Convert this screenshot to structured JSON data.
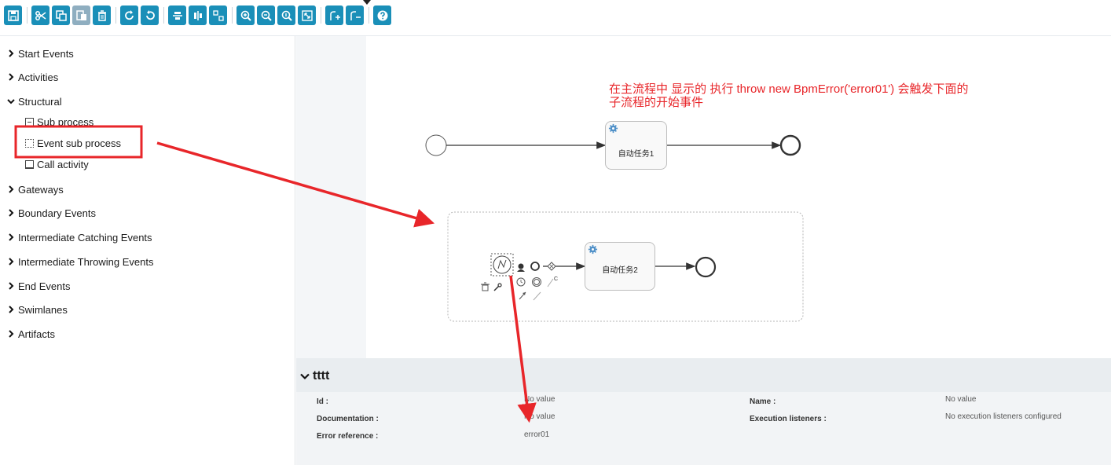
{
  "palette": {
    "groups": [
      {
        "label": "Start Events",
        "expanded": false
      },
      {
        "label": "Activities",
        "expanded": false
      },
      {
        "label": "Structural",
        "expanded": true
      },
      {
        "label": "Gateways",
        "expanded": false
      },
      {
        "label": "Boundary Events",
        "expanded": false
      },
      {
        "label": "Intermediate Catching Events",
        "expanded": false
      },
      {
        "label": "Intermediate Throwing Events",
        "expanded": false
      },
      {
        "label": "End Events",
        "expanded": false
      },
      {
        "label": "Swimlanes",
        "expanded": false
      },
      {
        "label": "Artifacts",
        "expanded": false
      }
    ],
    "structural_items": [
      "Sub process",
      "Event sub process",
      "Call activity"
    ]
  },
  "canvas": {
    "annotation_line1": "在主流程中 显示的 执行 throw new BpmError('error01') 会触发下面的",
    "annotation_line2": "子流程的开始事件",
    "task1_label": "自动任务1",
    "task2_label": "自动任务2"
  },
  "properties": {
    "title": "tttt",
    "rows": [
      {
        "label": "Id :",
        "value": "No value"
      },
      {
        "label": "Documentation :",
        "value": "No value"
      },
      {
        "label": "Error reference :",
        "value": "error01"
      }
    ],
    "rows_right": [
      {
        "label": "Name :",
        "value": "No value"
      },
      {
        "label": "Execution listeners :",
        "value": "No execution listeners configured"
      }
    ]
  },
  "colors": {
    "accent": "#1a8fb8",
    "annotation": "#e8262a",
    "panel_bg": "#e9edf0"
  }
}
